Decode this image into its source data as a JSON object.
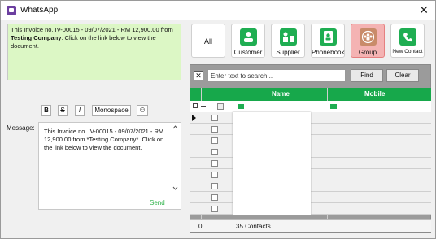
{
  "window": {
    "title": "WhatsApp",
    "close_glyph": "✕"
  },
  "preview": {
    "line1": "This Invoice no. IV-00015 - 09/07/2021 - RM 12,900.00 from",
    "bold": "Testing Company",
    "line2": ". Click on the link below to view the document."
  },
  "format_toolbar": {
    "bold": "B",
    "strike": "S",
    "italic": "I",
    "mono": "Monospace",
    "emoji": "☺"
  },
  "message": {
    "label": "Message:",
    "text": "This Invoice no. IV-00015 - 09/07/2021 - RM 12,900.00 from *Testing Company*. Click on the link below to view the document.",
    "send": "Send"
  },
  "categories": [
    {
      "label": "All",
      "icon": ""
    },
    {
      "label": "Customer",
      "icon": "customer-icon"
    },
    {
      "label": "Supplier",
      "icon": "supplier-icon"
    },
    {
      "label": "Phonebook",
      "icon": "phonebook-icon"
    },
    {
      "label": "Group",
      "icon": "group-icon",
      "selected": true
    },
    {
      "label": "New Contact",
      "icon": "new-contact-icon"
    }
  ],
  "search": {
    "placeholder": "Enter text to search...",
    "clear_glyph": "✕",
    "find": "Find",
    "clear": "Clear"
  },
  "grid": {
    "columns": [
      "Name",
      "Mobile"
    ],
    "footer_count": "0",
    "footer_contacts": "35 Contacts"
  },
  "colors": {
    "accent": "#17a84b",
    "preview_bg": "#dcf7c5",
    "group_selected": "#f4b3b3"
  }
}
